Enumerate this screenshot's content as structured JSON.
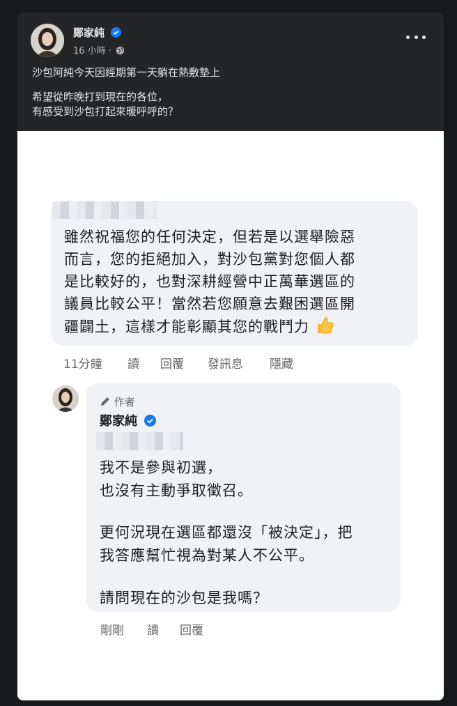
{
  "post": {
    "author": "鄭家純",
    "time": "16 小時 ·",
    "line1": "沙包阿純今天因經期第一天躺在熱敷墊上",
    "line2": "希望從昨晚打到現在的各位，",
    "line3": "有感受到沙包打起來暖呼呼的？"
  },
  "comment": {
    "lines": [
      "雖然祝福您的任何決定，但若是以選舉險惡",
      "而言，您的拒絕加入，對沙包黨對您個人都",
      "是比較好的，也對深耕經營中正萬華選區的",
      "議員比較公平！當然若您願意去艱困選區開",
      "疆闢土，這樣才能彰顯其您的戰鬥力"
    ],
    "emoji": "thumbs-up-icon",
    "time": "11分鐘",
    "read": "讀",
    "reply": "回覆",
    "message": "發訊息",
    "hide": "隱藏"
  },
  "reply": {
    "badge": "作者",
    "name": "鄭家純",
    "lines": [
      "我不是參與初選，",
      "也沒有主動爭取徵召。",
      "",
      "更何況現在選區都還沒「被決定」，把",
      "我答應幫忙視為對某人不公平。",
      "",
      "請問現在的沙包是我嗎？"
    ],
    "time": "剛剛",
    "read": "讀",
    "reply": "回覆"
  },
  "colors": {
    "verified": "#1877f2",
    "dark_bg": "#242526",
    "bubble_bg": "#f0f2f5"
  }
}
